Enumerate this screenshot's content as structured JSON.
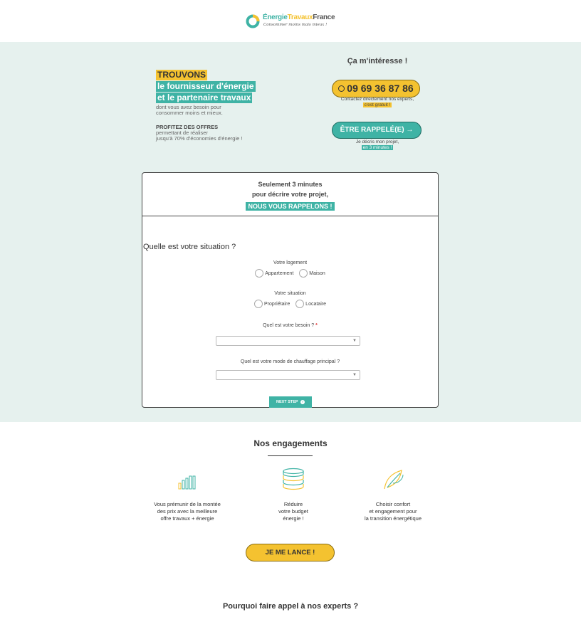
{
  "brand": {
    "name_part1": "Énergie",
    "name_part2": "Travaux",
    "name_part3": "France",
    "tagline": "Consommer moins mais mieux !"
  },
  "pitch": {
    "line1": "TROUVONS",
    "line2": "le fournisseur d'énergie",
    "line3": "et le partenaire travaux",
    "sub1": "dont vous avez besoin pour",
    "sub2": "consommer moins et mieux.",
    "offers_title": "PROFITEZ DES OFFRES",
    "offers1": "permettant de réaliser",
    "offers2": "jusqu'à 70% d'économies d'énergie !"
  },
  "contact": {
    "title": "Ça m'intéresse !",
    "phone": "09 69 36 87 86",
    "phone_note": "Contactez directement nos experts,",
    "phone_note_highlight": "c'est gratuit !",
    "callback_label": "ÊTRE RAPPELÉ(E) →",
    "callback_note": "Je décris mon projet,",
    "callback_note_highlight": "en 3 minutes !"
  },
  "form": {
    "header_line1": "Seulement 3 minutes",
    "header_line2": "pour décrire votre projet,",
    "header_tag": "NOUS VOUS RAPPELONS !",
    "question": "Quelle est votre situation ?",
    "logement_label": "Votre logement",
    "logement_opt1": "Appartement",
    "logement_opt2": "Maison",
    "situation_label": "Votre situation",
    "situation_opt1": "Propriétaire",
    "situation_opt2": "Locataire",
    "besoin_label": "Quel est votre besoin ?",
    "besoin_required": "*",
    "chauffage_label": "Quel est votre mode de chauffage principal ?",
    "next_label": "NEXT STEP"
  },
  "engagements": {
    "title": "Nos engagements",
    "items": [
      {
        "icon": "bar-chart-icon",
        "line1": "Vous prémunir de la montée",
        "line2": "des prix avec la meilleure",
        "line3": "offre travaux + énergie"
      },
      {
        "icon": "coin-stack-icon",
        "line1": "Réduire",
        "line2": "votre budget",
        "line3": "énergie !"
      },
      {
        "icon": "leaf-icon",
        "line1": "Choisir confort",
        "line2": "et engagement pour",
        "line3": "la transition énergétique"
      }
    ],
    "cta": "JE ME LANCE !"
  },
  "experts": {
    "title": "Pourquoi faire appel à nos experts ?"
  },
  "colors": {
    "teal": "#3fb3a5",
    "yellow": "#f4c230",
    "mint_bg": "#e6f1ee"
  }
}
